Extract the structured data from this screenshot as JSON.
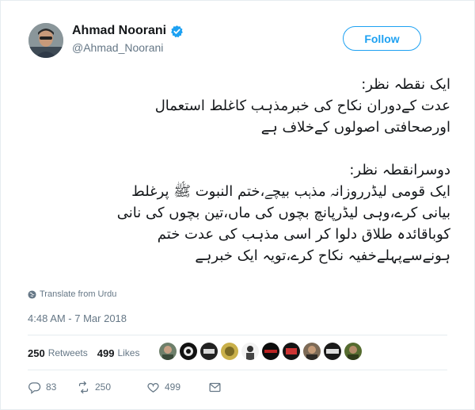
{
  "author": {
    "name": "Ahmad Noorani",
    "handle": "@Ahmad_Noorani"
  },
  "follow_label": "Follow",
  "tweet": {
    "lines": [
      "ایک نقطہ نظر:",
      "عدت کےدوران نکاح کی خبرمذہب کاغلط استعمال",
      "اورصحافتی اصولوں کےخلاف ہے",
      "",
      "دوسرانقطہ نظر:",
      "ایک قومی لیڈرروزانہ مذہب بیچے،ختم النبوت ﷺ پرغلط",
      "بیانی کرے،وہی لیڈرپانچ بچوں کی ماں،تین بچوں کی نانی",
      "کوباقائدہ طلاق دلوا کر اسی مذہب کی عدت ختم",
      "ہونےسےپہلےخفیہ نکاح کرے،تویہ ایک خبرہے"
    ]
  },
  "translate_label": "Translate from Urdu",
  "timestamp": "4:48 AM - 7 Mar 2018",
  "stats": {
    "retweets_count": "250",
    "retweets_label": "Retweets",
    "likes_count": "499",
    "likes_label": "Likes"
  },
  "actions": {
    "reply_count": "83",
    "retweet_count": "250",
    "like_count": "499"
  },
  "icons": {
    "verified": "verified-badge-icon",
    "globe": "globe-icon",
    "reply": "reply-icon",
    "retweet": "retweet-icon",
    "like": "heart-icon",
    "message": "envelope-icon"
  },
  "colors": {
    "accent": "#1da1f2",
    "text": "#14171a",
    "muted": "#657786",
    "border": "#e6ecf0"
  }
}
